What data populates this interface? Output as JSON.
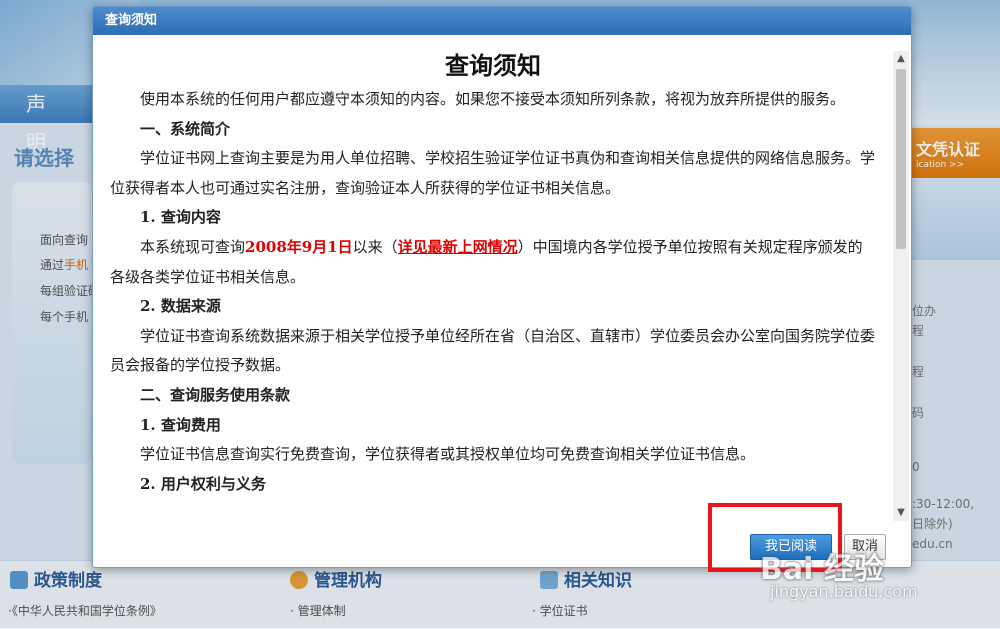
{
  "background": {
    "nav_left": "声明",
    "choose_text": "请选择",
    "left_lines": [
      {
        "text": "面向查询",
        "highlight": ""
      },
      {
        "text": "通过",
        "highlight": "手机"
      },
      {
        "text": "每组验证码",
        "highlight": ""
      },
      {
        "text": "每个手机",
        "highlight": ""
      }
    ],
    "right_banner": {
      "title": "文凭认证",
      "sub": "ication >>"
    },
    "right_lines": [
      "位办",
      "程",
      "程",
      "码",
      "0",
      ":30-12:00,",
      "日除外)",
      "edu.cn"
    ],
    "bottom_columns": [
      {
        "title": "政策制度",
        "sub": "·《中华人民共和国学位条例》",
        "icon_color": "#5b9bd5"
      },
      {
        "title": "管理机构",
        "sub": "· 管理体制",
        "icon_color": "#e8a33a"
      },
      {
        "title": "相关知识",
        "sub": "· 学位证书",
        "icon_color": "#7bb0de"
      }
    ]
  },
  "modal": {
    "titlebar": "查询须知",
    "heading": "查询须知",
    "intro": "使用本系统的任何用户都应遵守本须知的内容。如果您不接受本须知所列条款，将视为放弃所提供的服务。",
    "sec1_title": "一、系统简介",
    "sec1_text": "学位证书网上查询主要是为用人单位招聘、学校招生验证学位证书真伪和查询相关信息提供的网络信息服务。学位获得者本人也可通过实名注册，查询验证本人所获得的学位证书相关信息。",
    "sub1_title": "1. 查询内容",
    "sub1_part1": "本系统现可查询",
    "sub1_date": "2008年9月1日",
    "sub1_part2": "以来（",
    "sub1_link": "详见最新上网情况",
    "sub1_part3": "）中国境内各学位授予单位按照有关规定程序颁发的各级各类学位证书相关信息。",
    "sub2_title": "2. 数据来源",
    "sub2_text": "学位证书查询系统数据来源于相关学位授予单位经所在省（自治区、直辖市）学位委员会办公室向国务院学位委员会报备的学位授予数据。",
    "sec2_title": "二、查询服务使用条款",
    "sec2_sub1_title": "1. 查询费用",
    "sec2_sub1_text": "学位证书信息查询实行免费查询，学位获得者或其授权单位均可免费查询相关学位证书信息。",
    "sec2_sub2_title": "2. 用户权利与义务",
    "btn_read": "我已阅读",
    "btn_cancel": "取消",
    "scroll_up_icon": "chevron-up-icon",
    "scroll_down_icon": "chevron-down-icon"
  },
  "watermark": {
    "logo": "Bai 经验",
    "url": "jingyan.baidu.com"
  },
  "colors": {
    "titlebar": "#3a7bbf",
    "highlight": "#e00000",
    "annotation": "#e8151b",
    "primary_button": "#2d7fcb"
  }
}
